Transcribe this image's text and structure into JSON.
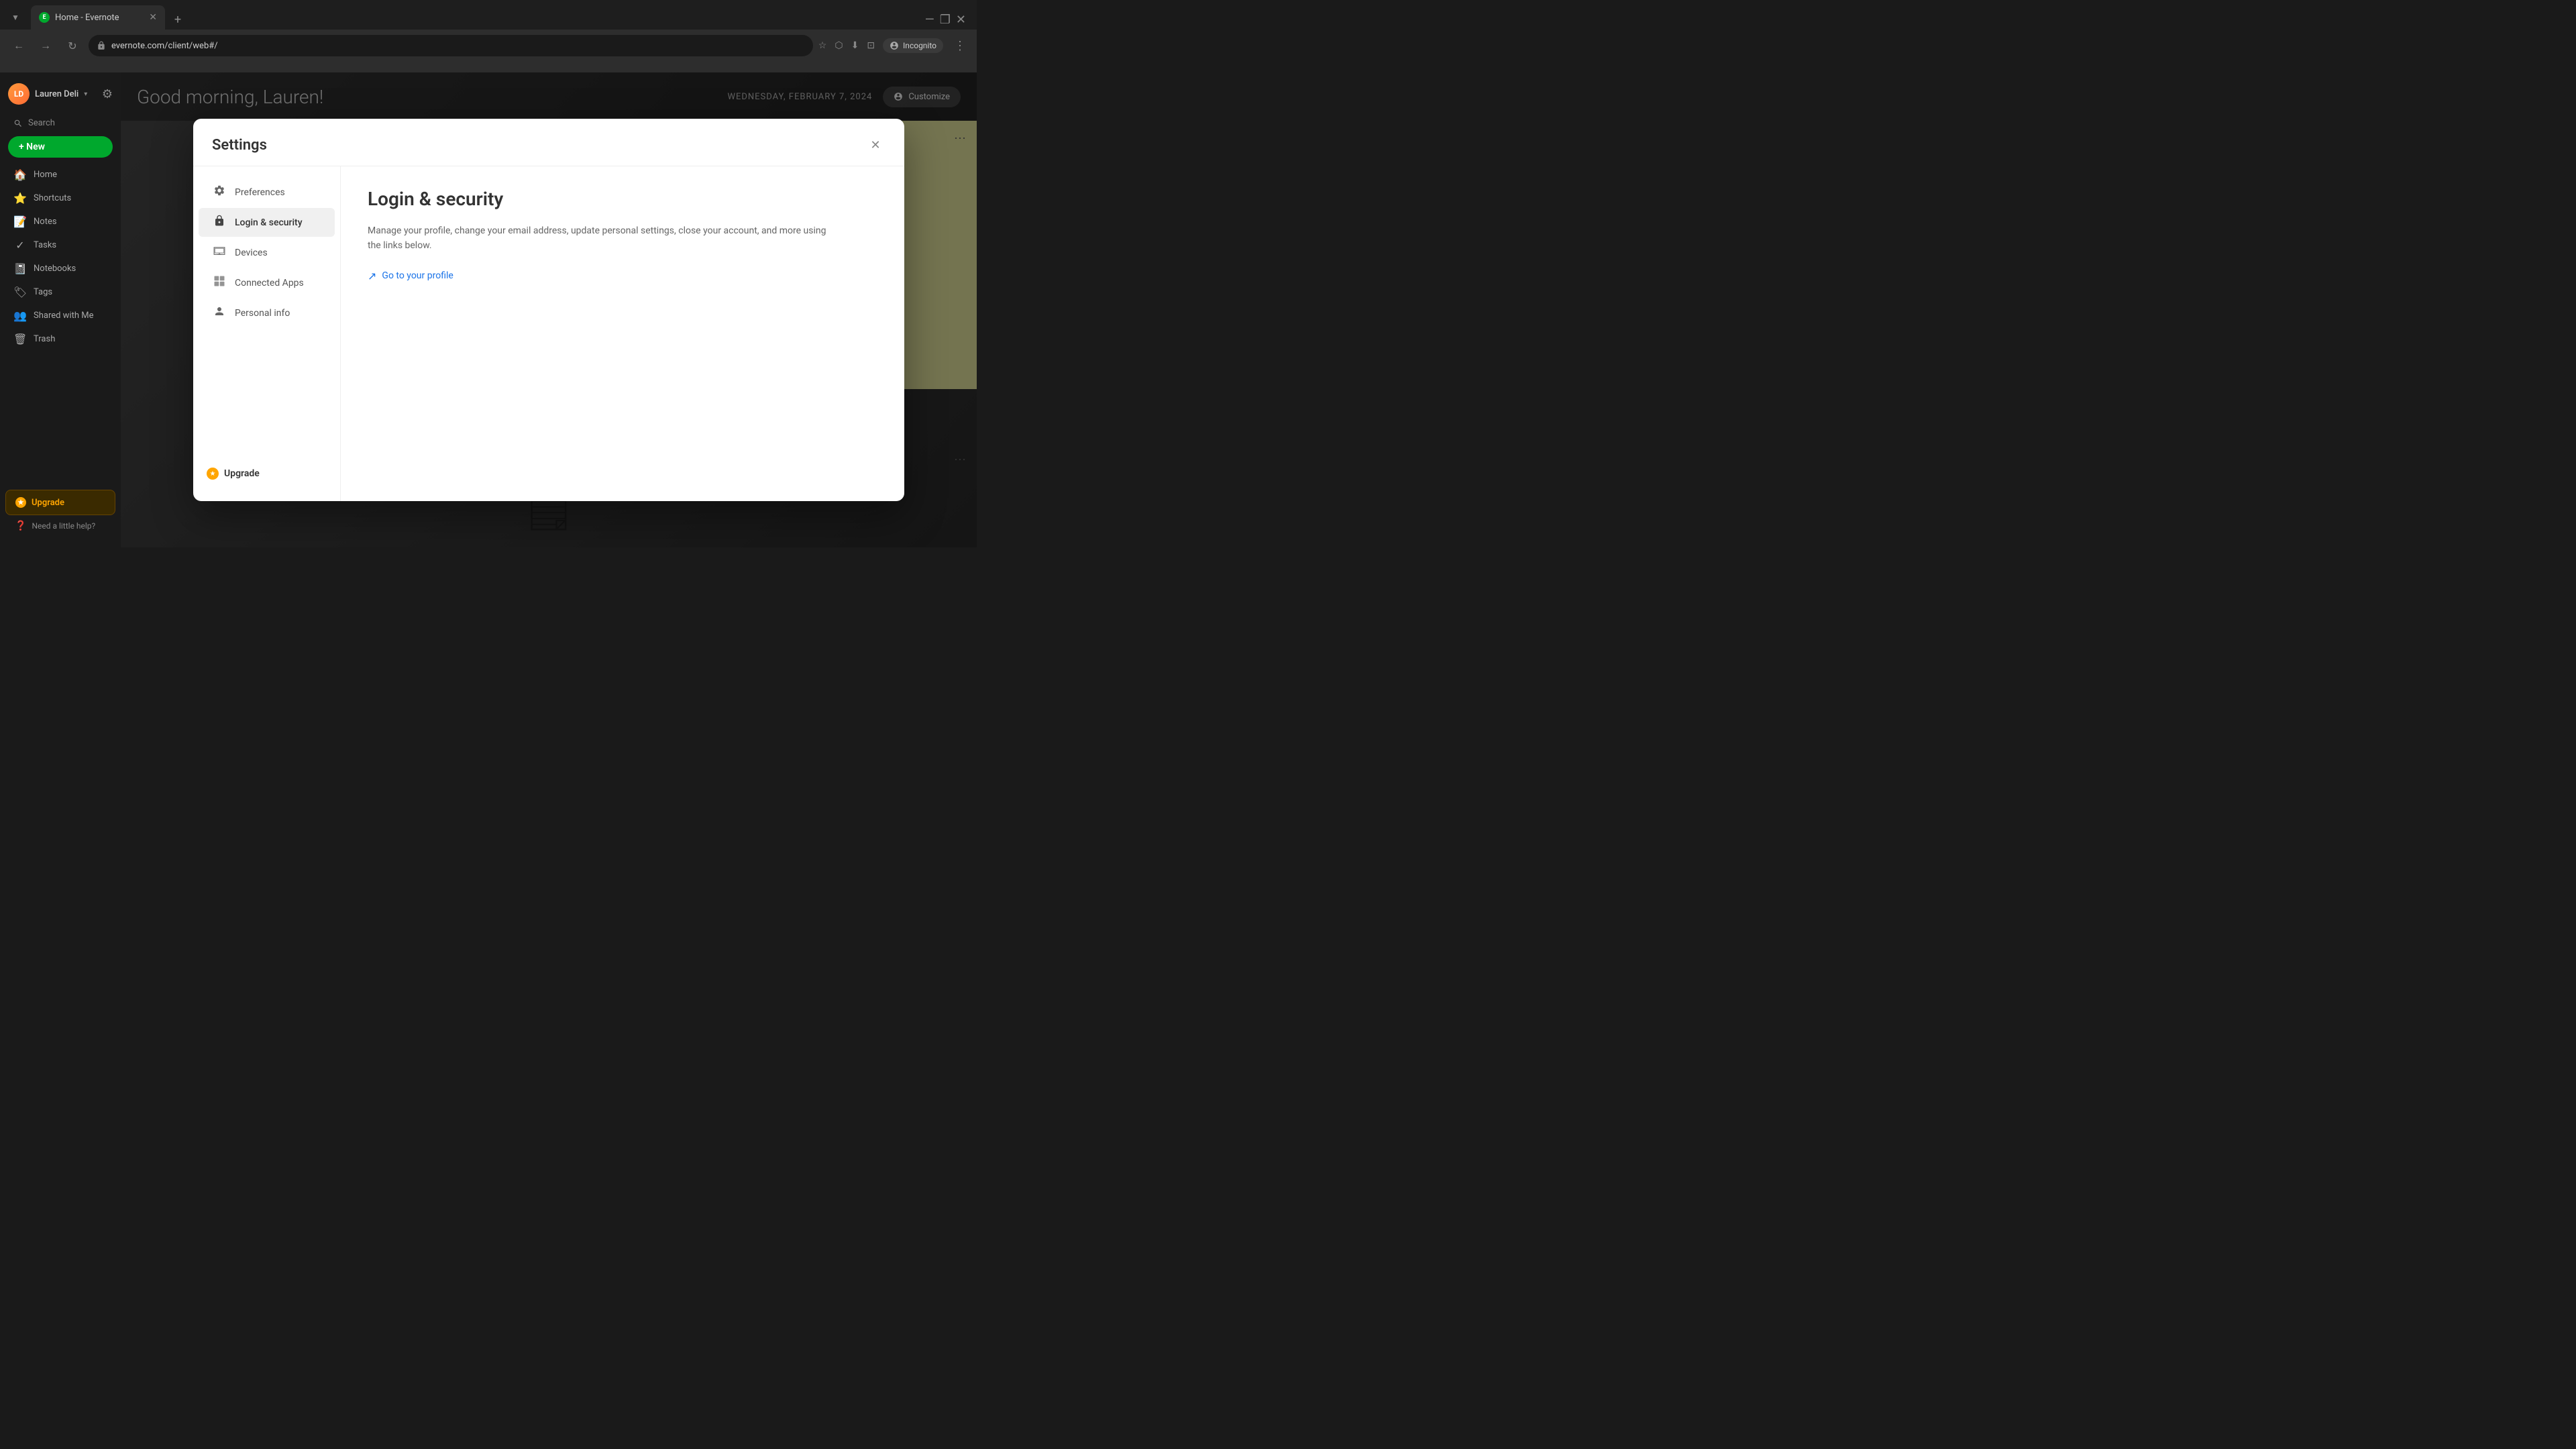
{
  "browser": {
    "tab_title": "Home - Evernote",
    "tab_favicon": "E",
    "new_tab_icon": "+",
    "url": "evernote.com/client/web#/",
    "incognito_label": "Incognito",
    "window_controls": {
      "minimize": "—",
      "maximize": "❐",
      "close": "✕"
    },
    "nav": {
      "back": "←",
      "forward": "→",
      "reload": "↻"
    }
  },
  "sidebar": {
    "user_name": "Lauren Deli",
    "user_initials": "LD",
    "search_label": "Search",
    "new_button_label": "+ New",
    "nav_items": [
      {
        "id": "home",
        "label": "Home",
        "icon": "🏠"
      },
      {
        "id": "shortcuts",
        "label": "Shortcuts",
        "icon": "⭐"
      },
      {
        "id": "notes",
        "label": "Notes",
        "icon": "📝"
      },
      {
        "id": "tasks",
        "label": "Tasks",
        "icon": "✓"
      },
      {
        "id": "notebooks",
        "label": "Notebooks",
        "icon": "📓"
      },
      {
        "id": "tags",
        "label": "Tags",
        "icon": "🏷"
      },
      {
        "id": "shared",
        "label": "Shared with Me",
        "icon": "👥"
      },
      {
        "id": "trash",
        "label": "Trash",
        "icon": "🗑"
      }
    ],
    "upgrade_button_label": "Upgrade",
    "help_label": "Need a little help?"
  },
  "main": {
    "greeting": "Good morning, Lauren!",
    "date": "WEDNESDAY, FEBRUARY 7, 2024",
    "customize_label": "Customize"
  },
  "settings_modal": {
    "title": "Settings",
    "close_icon": "✕",
    "nav_items": [
      {
        "id": "preferences",
        "label": "Preferences",
        "icon": "⚙"
      },
      {
        "id": "login_security",
        "label": "Login & security",
        "icon": "🔒",
        "active": true
      },
      {
        "id": "devices",
        "label": "Devices",
        "icon": "📱"
      },
      {
        "id": "connected_apps",
        "label": "Connected Apps",
        "icon": "⊞"
      },
      {
        "id": "personal_info",
        "label": "Personal info",
        "icon": "👤"
      }
    ],
    "upgrade_label": "Upgrade",
    "content": {
      "title": "Login & security",
      "description": "Manage your profile, change your email address, update personal settings, close your account, and more using the links below.",
      "link_text": "Go to your profile",
      "link_icon": "↗"
    }
  }
}
